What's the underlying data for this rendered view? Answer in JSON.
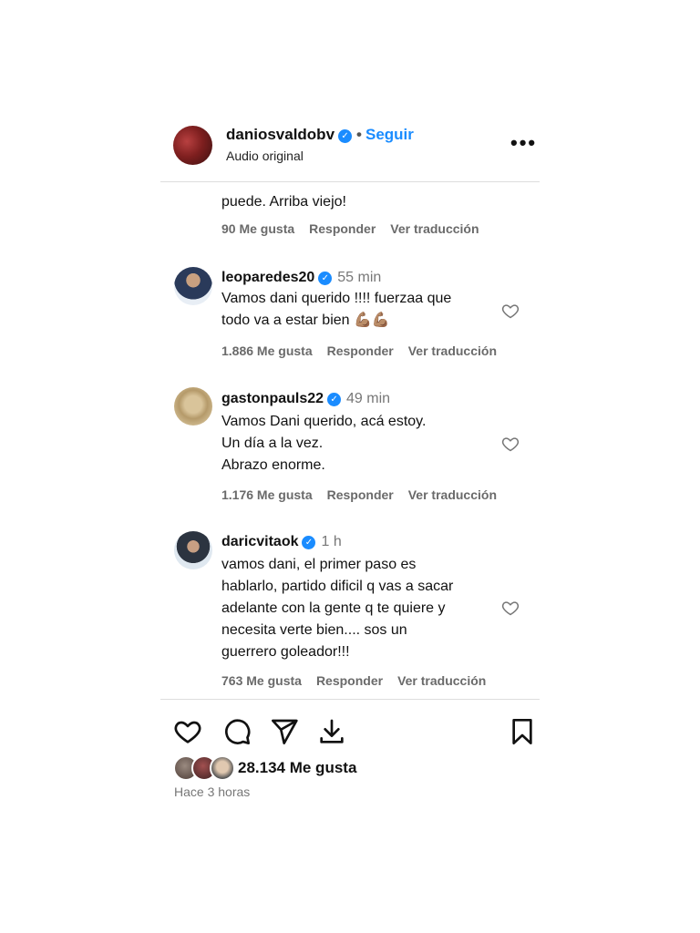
{
  "header": {
    "username": "daniosvaldobv",
    "verified_icon": "verified-badge",
    "separator": "•",
    "follow_label": "Seguir",
    "subtitle": "Audio original",
    "more_label": "•••"
  },
  "comments": [
    {
      "text_lines": [
        "puede. Arriba viejo!"
      ],
      "likes": "90 Me gusta",
      "reply": "Responder",
      "translate": "Ver traducción"
    },
    {
      "username": "leoparedes20",
      "time": "55 min",
      "text_lines": [
        "Vamos dani querido !!!! fuerzaa que",
        "todo va a estar bien 💪🏽💪🏽"
      ],
      "likes": "1.886 Me gusta",
      "reply": "Responder",
      "translate": "Ver traducción"
    },
    {
      "username": "gastonpauls22",
      "time": "49 min",
      "text_lines": [
        "Vamos Dani querido, acá estoy.",
        "Un día a la vez.",
        "Abrazo enorme."
      ],
      "likes": "1.176 Me gusta",
      "reply": "Responder",
      "translate": "Ver traducción"
    },
    {
      "username": "daricvitaok",
      "time": "1 h",
      "text_lines": [
        "vamos dani, el primer paso es",
        "hablarlo, partido dificil q vas a sacar",
        "adelante con la gente q te quiere y",
        "necesita verte bien.... sos un",
        "guerrero goleador!!!"
      ],
      "likes": "763 Me gusta",
      "reply": "Responder",
      "translate": "Ver traducción"
    }
  ],
  "post": {
    "likes": "28.134 Me gusta",
    "time_ago": "Hace 3 horas"
  },
  "colors": {
    "accent": "#1a8cff",
    "muted": "#6a6a6a",
    "divider": "#dddddd"
  }
}
